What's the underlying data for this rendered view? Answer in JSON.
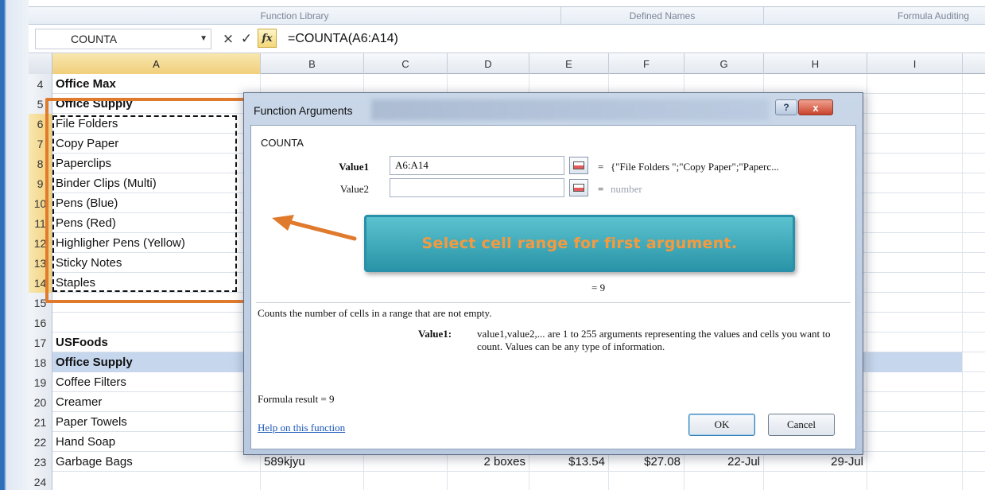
{
  "ribbon": {
    "groups": [
      "Function Library",
      "Defined Names",
      "Formula Auditing"
    ]
  },
  "formula_bar": {
    "name_box": "COUNTA",
    "cancel_glyph": "×",
    "enter_glyph": "✓",
    "fx_label": "fx",
    "formula": "=COUNTA(A6:A14)"
  },
  "columns": [
    "A",
    "B",
    "C",
    "D",
    "E",
    "F",
    "G",
    "H",
    "I"
  ],
  "rows": [
    {
      "num": "4",
      "a": "Office Max",
      "bold": true
    },
    {
      "num": "5",
      "a": "Office Supply",
      "bold": true
    },
    {
      "num": "6",
      "a": "File Folders"
    },
    {
      "num": "7",
      "a": "Copy Paper"
    },
    {
      "num": "8",
      "a": "Paperclips"
    },
    {
      "num": "9",
      "a": "Binder Clips (Multi)"
    },
    {
      "num": "10",
      "a": "Pens (Blue)"
    },
    {
      "num": "11",
      "a": "Pens (Red)"
    },
    {
      "num": "12",
      "a": "Highligher Pens (Yellow)"
    },
    {
      "num": "13",
      "a": "Sticky Notes"
    },
    {
      "num": "14",
      "a": "Staples"
    },
    {
      "num": "15",
      "a": ""
    },
    {
      "num": "16",
      "a": ""
    },
    {
      "num": "17",
      "a": "USFoods",
      "bold": true
    },
    {
      "num": "18",
      "a": "Office Supply",
      "bold": true
    },
    {
      "num": "19",
      "a": "Coffee Filters"
    },
    {
      "num": "20",
      "a": "Creamer"
    },
    {
      "num": "21",
      "a": "Paper Towels"
    },
    {
      "num": "22",
      "a": "Hand Soap"
    },
    {
      "num": "23",
      "a": "Garbage Bags",
      "b": "589kjyu",
      "d": "2 boxes",
      "e": "$13.54",
      "f": "$27.08",
      "g": "22-Jul",
      "h": "29-Jul"
    },
    {
      "num": "24",
      "a": ""
    }
  ],
  "dialog": {
    "title": "Function Arguments",
    "help_button": "?",
    "close_button": "x",
    "function_name": "COUNTA",
    "value1_label": "Value1",
    "value1_input": "A6:A14",
    "value1_result": "{\"File Folders \";\"Copy Paper\";\"Paperc...",
    "value2_label": "Value2",
    "value2_input": "",
    "value2_result": "number",
    "equals": "=",
    "total_result": "=  9",
    "description": "Counts the number of cells in a range that are not empty.",
    "detail_label": "Value1:",
    "detail_text": "value1,value2,... are 1 to 255 arguments representing the values and cells you want to count. Values can be any type of information.",
    "formula_result": "Formula result =  9",
    "help_link": "Help on this function",
    "ok": "OK",
    "cancel": "Cancel"
  },
  "callout": {
    "text": "Select cell range for first argument."
  },
  "colors": {
    "accent_orange": "#e07a2c",
    "callout_teal": "#2a95a8",
    "selection_blue": "#c5d6ed"
  }
}
